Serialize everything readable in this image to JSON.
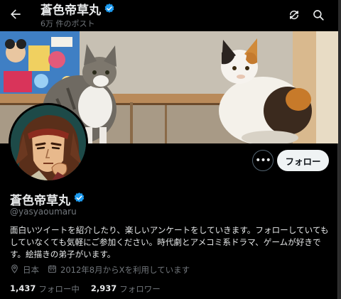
{
  "header": {
    "name": "蒼色帝草丸",
    "post_count": "6万 件のポスト"
  },
  "profile": {
    "name": "蒼色帝草丸",
    "handle": "@yasyaoumaru",
    "bio": "面白いツイートを紹介したり、楽しいアンケートをしていきます。フォローしていてもしていなくても気軽にご参加ください。時代劇とアメコミ系ドラマ、ゲームが好きです。絵描きの弟子がいます。",
    "location": "日本",
    "joined": "2012年8月からXを利用しています",
    "verified_color": "#1d9bf0"
  },
  "actions": {
    "more_label": "•••",
    "follow_label": "フォロー"
  },
  "stats": {
    "following_count": "1,437",
    "following_label": "フォロー中",
    "followers_count": "2,937",
    "followers_label": "フォロワー"
  },
  "icons": [
    "back-arrow-icon",
    "verified-badge-icon",
    "refresh-icon",
    "search-icon",
    "location-icon",
    "calendar-icon"
  ]
}
